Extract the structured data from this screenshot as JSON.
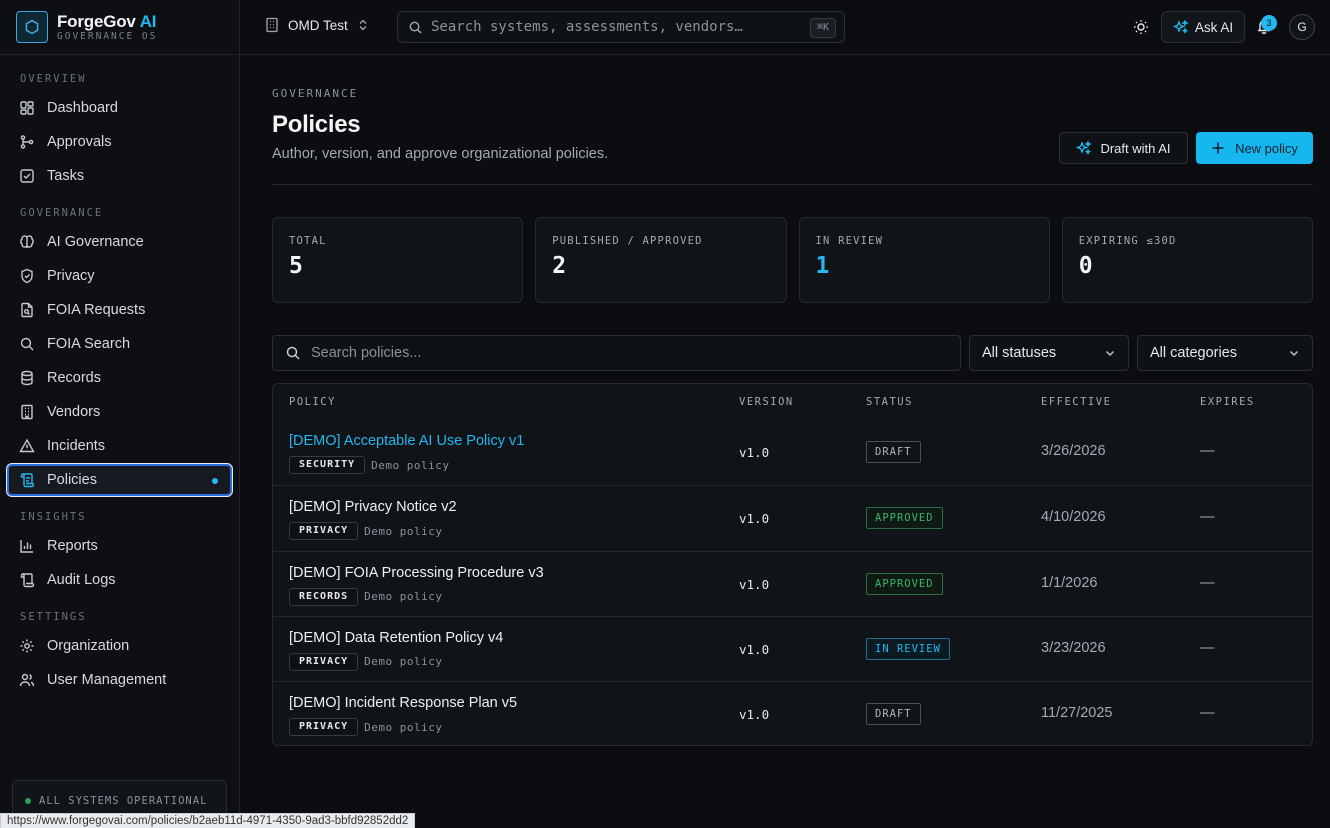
{
  "brand": {
    "name": "ForgeGov",
    "ai": "AI",
    "sub": "GOVERNANCE OS"
  },
  "sidebar": {
    "sections": [
      {
        "title": "OVERVIEW",
        "items": [
          {
            "label": "Dashboard",
            "icon": "grid-icon"
          },
          {
            "label": "Approvals",
            "icon": "git-branch-icon"
          },
          {
            "label": "Tasks",
            "icon": "checkbox-icon"
          }
        ]
      },
      {
        "title": "GOVERNANCE",
        "items": [
          {
            "label": "AI Governance",
            "icon": "brain-icon"
          },
          {
            "label": "Privacy",
            "icon": "shield-icon"
          },
          {
            "label": "FOIA Requests",
            "icon": "file-search-icon"
          },
          {
            "label": "FOIA Search",
            "icon": "search-icon"
          },
          {
            "label": "Records",
            "icon": "database-icon"
          },
          {
            "label": "Vendors",
            "icon": "building-icon"
          },
          {
            "label": "Incidents",
            "icon": "warning-icon"
          },
          {
            "label": "Policies",
            "icon": "scroll-icon",
            "active": true
          }
        ]
      },
      {
        "title": "INSIGHTS",
        "items": [
          {
            "label": "Reports",
            "icon": "bar-chart-icon"
          },
          {
            "label": "Audit Logs",
            "icon": "log-icon"
          }
        ]
      },
      {
        "title": "SETTINGS",
        "items": [
          {
            "label": "Organization",
            "icon": "gear-icon"
          },
          {
            "label": "User Management",
            "icon": "users-icon"
          }
        ]
      }
    ],
    "status": "ALL SYSTEMS OPERATIONAL"
  },
  "topbar": {
    "org": "OMD Test",
    "search_placeholder": "Search systems, assessments, vendors…",
    "shortcut": "⌘K",
    "ask_ai": "Ask AI",
    "notifications": "3",
    "avatar": "G"
  },
  "page": {
    "eyebrow": "GOVERNANCE",
    "title": "Policies",
    "subtitle": "Author, version, and approve organizational policies.",
    "draft_button": "Draft with AI",
    "new_button": "New policy"
  },
  "stats": [
    {
      "label": "TOTAL",
      "value": "5"
    },
    {
      "label": "PUBLISHED / APPROVED",
      "value": "2"
    },
    {
      "label": "IN REVIEW",
      "value": "1"
    },
    {
      "label": "EXPIRING ≤30D",
      "value": "0"
    }
  ],
  "filters": {
    "search_placeholder": "Search policies...",
    "status": "All statuses",
    "category": "All categories"
  },
  "table": {
    "headers": [
      "POLICY",
      "VERSION",
      "STATUS",
      "EFFECTIVE",
      "EXPIRES"
    ],
    "rows": [
      {
        "name": "[DEMO] Acceptable AI Use Policy v1",
        "tag": "SECURITY",
        "note": "Demo policy",
        "version": "v1.0",
        "status": "DRAFT",
        "effective": "3/26/2026",
        "expires": "—"
      },
      {
        "name": "[DEMO] Privacy Notice v2",
        "tag": "PRIVACY",
        "note": "Demo policy",
        "version": "v1.0",
        "status": "APPROVED",
        "effective": "4/10/2026",
        "expires": "—"
      },
      {
        "name": "[DEMO] FOIA Processing Procedure v3",
        "tag": "RECORDS",
        "note": "Demo policy",
        "version": "v1.0",
        "status": "APPROVED",
        "effective": "1/1/2026",
        "expires": "—"
      },
      {
        "name": "[DEMO] Data Retention Policy v4",
        "tag": "PRIVACY",
        "note": "Demo policy",
        "version": "v1.0",
        "status": "IN REVIEW",
        "effective": "3/23/2026",
        "expires": "—"
      },
      {
        "name": "[DEMO] Incident Response Plan v5",
        "tag": "PRIVACY",
        "note": "Demo policy",
        "version": "v1.0",
        "status": "DRAFT",
        "effective": "11/27/2025",
        "expires": "—"
      }
    ]
  },
  "status_url": "https://www.forgegovai.com/policies/b2aeb11d-4971-4350-9ad3-bbfd92852dd2",
  "colors": {
    "accent": "#22b8f0",
    "approved": "#37b46a",
    "background": "#0b0d10"
  }
}
